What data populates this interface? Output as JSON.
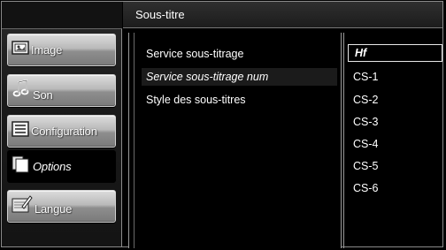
{
  "header": {
    "title": "Sous-titre"
  },
  "sidebar": {
    "items": [
      {
        "label": "Image",
        "icon": "picture-icon"
      },
      {
        "label": "Son",
        "icon": "music-note-icon"
      },
      {
        "label": "Configuration",
        "icon": "list-icon"
      },
      {
        "label": "Options",
        "icon": "pages-icon"
      },
      {
        "label": "Langue",
        "icon": "keyboard-icon"
      }
    ]
  },
  "submenu": {
    "items": [
      {
        "label": "Service sous-titrage"
      },
      {
        "label": "Service sous-titrage num"
      },
      {
        "label": "Style des sous-titres"
      }
    ]
  },
  "options": {
    "items": [
      {
        "label": "Hf"
      },
      {
        "label": "CS-1"
      },
      {
        "label": "CS-2"
      },
      {
        "label": "CS-3"
      },
      {
        "label": "CS-4"
      },
      {
        "label": "CS-5"
      },
      {
        "label": "CS-6"
      }
    ]
  }
}
